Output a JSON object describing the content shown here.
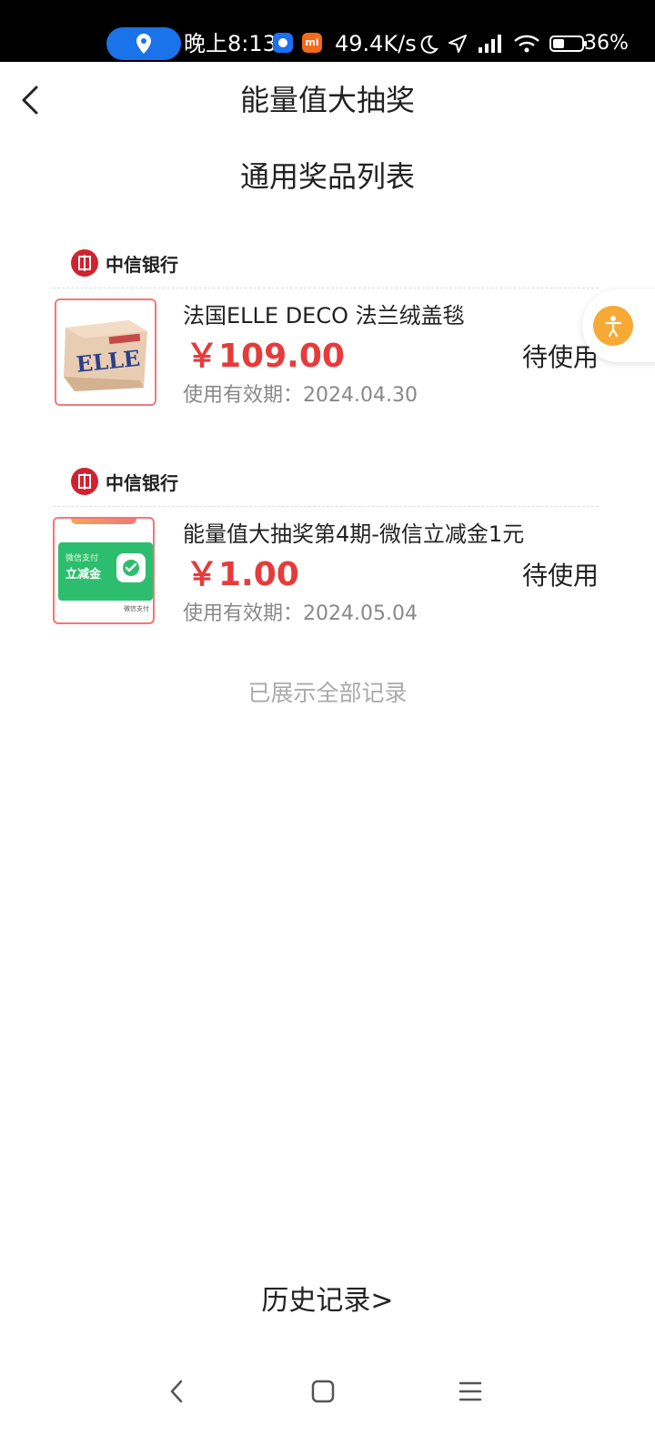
{
  "statusbar": {
    "time": "晚上8:13",
    "speed": "49.4K/s",
    "battery": "36%"
  },
  "header": {
    "title": "能量值大抽奖"
  },
  "section": {
    "title": "通用奖品列表"
  },
  "prizes": [
    {
      "brand": "中信银行",
      "name": "法国ELLE DECO 法兰绒盖毯",
      "price": "￥109.00",
      "status": "待使用",
      "valid": "使用有效期：2024.04.30",
      "thumb_text": "ELLE"
    },
    {
      "brand": "中信银行",
      "name": "能量值大抽奖第4期-微信立减金1元",
      "price": "￥1.00",
      "status": "待使用",
      "valid": "使用有效期：2024.05.04",
      "thumb_caption": "微信支付",
      "thumb_text": "立减金",
      "thumb_footer": "微信支付"
    }
  ],
  "end_note": "已展示全部记录",
  "history_link": "历史记录>",
  "colors": {
    "price": "#e63b3b",
    "accent_orange": "#f7a935",
    "brand_red": "#d0232f",
    "wechat_green": "#2dbd6e"
  },
  "icons": [
    "location-icon",
    "back-arrow-icon",
    "accessibility-icon",
    "nav-back-icon",
    "nav-home-icon",
    "nav-menu-icon"
  ]
}
